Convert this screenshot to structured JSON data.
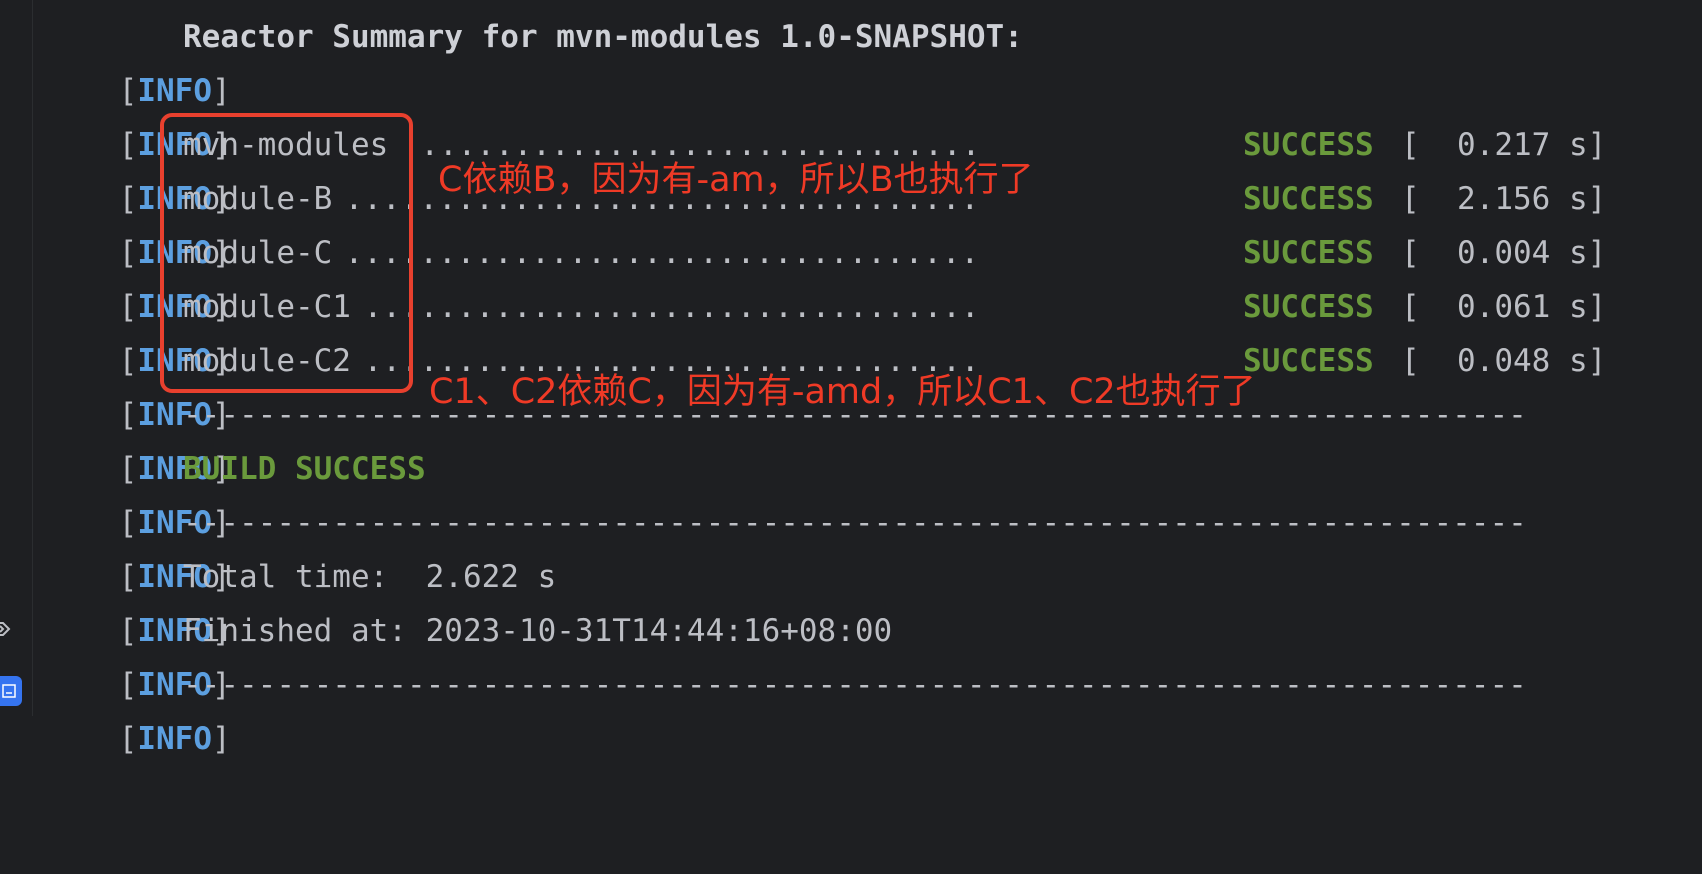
{
  "gutter": {
    "icons": [
      "execute-icon",
      "terminal-icon"
    ]
  },
  "prefix": {
    "open": "[",
    "tag": "INFO",
    "close": "]"
  },
  "console": {
    "summary_title": "Reactor Summary for mvn-modules 1.0-SNAPSHOT:",
    "modules": [
      {
        "name": "mvn-modules",
        "dots": " ...............................",
        "status": "SUCCESS",
        "time": "[  0.217 s]"
      },
      {
        "name": "module-B",
        "dots": " ..................................",
        "status": "SUCCESS",
        "time": "[  2.156 s]"
      },
      {
        "name": "module-C",
        "dots": " ..................................",
        "status": "SUCCESS",
        "time": "[  0.004 s]"
      },
      {
        "name": "module-C1",
        "dots": " .................................",
        "status": "SUCCESS",
        "time": "[  0.061 s]"
      },
      {
        "name": "module-C2",
        "dots": " .................................",
        "status": "SUCCESS",
        "time": "[  0.048 s]"
      }
    ],
    "separator": "------------------------------------------------------------------------",
    "build_result": "BUILD SUCCESS",
    "total_time": "Total time:  2.622 s",
    "finished_at": "Finished at: 2023-10-31T14:44:16+08:00"
  },
  "annotations": {
    "note_1": "C依赖B，因为有-am，所以B也执行了",
    "note_2": "C1、C2依赖C，因为有-amd，所以C1、C2也执行了",
    "box_color": "#e8402e"
  },
  "colors": {
    "background": "#1e1f22",
    "info_tag": "#5c9fe0",
    "success": "#6a9a3c",
    "text": "#bcbec4",
    "annotation": "#ef3a26"
  }
}
